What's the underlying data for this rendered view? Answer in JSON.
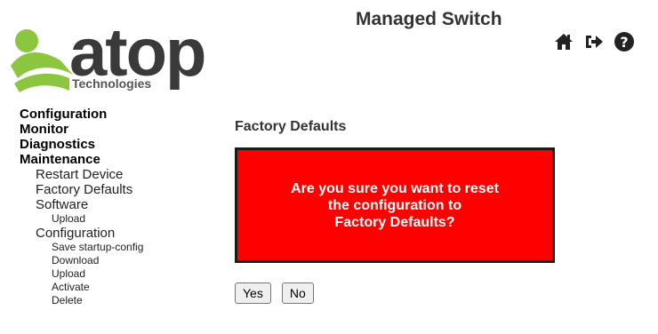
{
  "header": {
    "title": "Managed Switch",
    "logo": {
      "text": "atop",
      "subtitle": "Technologies"
    },
    "icons": [
      "home-icon",
      "logout-icon",
      "help-icon"
    ]
  },
  "sidebar": {
    "configuration": "Configuration",
    "monitor": "Monitor",
    "diagnostics": "Diagnostics",
    "maintenance": "Maintenance",
    "maintenance_items": {
      "restart_device": "Restart Device",
      "factory_defaults": "Factory Defaults",
      "software": "Software",
      "software_upload": "Upload",
      "configuration": "Configuration",
      "save_startup_config": "Save startup-config",
      "download": "Download",
      "upload": "Upload",
      "activate": "Activate",
      "delete": "Delete"
    }
  },
  "main": {
    "title": "Factory Defaults",
    "warning": "Are you sure you want to reset\nthe configuration to\nFactory Defaults?",
    "yes_label": "Yes",
    "no_label": "No"
  },
  "colors": {
    "warning_bg": "#ff0000",
    "warning_text": "#ffffff",
    "logo_green": "#8cc63f",
    "logo_text": "#3a3a3a"
  }
}
